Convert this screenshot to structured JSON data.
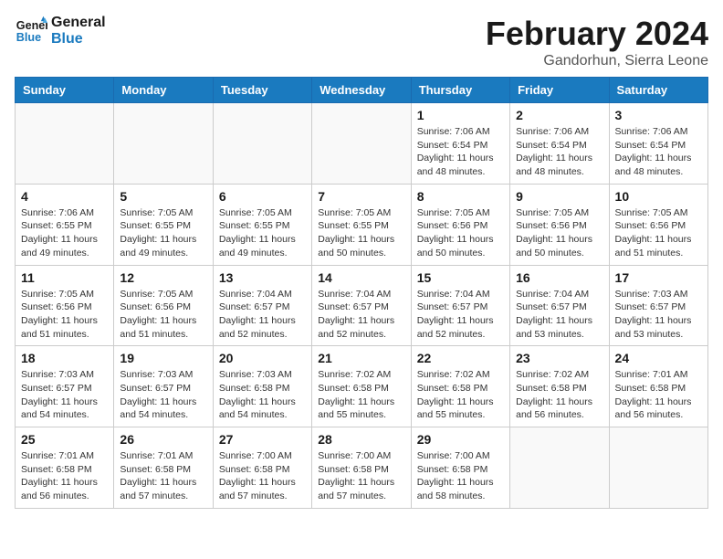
{
  "header": {
    "logo_line1": "General",
    "logo_line2": "Blue",
    "title": "February 2024",
    "subtitle": "Gandorhun, Sierra Leone"
  },
  "weekdays": [
    "Sunday",
    "Monday",
    "Tuesday",
    "Wednesday",
    "Thursday",
    "Friday",
    "Saturday"
  ],
  "weeks": [
    [
      {
        "day": "",
        "info": ""
      },
      {
        "day": "",
        "info": ""
      },
      {
        "day": "",
        "info": ""
      },
      {
        "day": "",
        "info": ""
      },
      {
        "day": "1",
        "info": "Sunrise: 7:06 AM\nSunset: 6:54 PM\nDaylight: 11 hours\nand 48 minutes."
      },
      {
        "day": "2",
        "info": "Sunrise: 7:06 AM\nSunset: 6:54 PM\nDaylight: 11 hours\nand 48 minutes."
      },
      {
        "day": "3",
        "info": "Sunrise: 7:06 AM\nSunset: 6:54 PM\nDaylight: 11 hours\nand 48 minutes."
      }
    ],
    [
      {
        "day": "4",
        "info": "Sunrise: 7:06 AM\nSunset: 6:55 PM\nDaylight: 11 hours\nand 49 minutes."
      },
      {
        "day": "5",
        "info": "Sunrise: 7:05 AM\nSunset: 6:55 PM\nDaylight: 11 hours\nand 49 minutes."
      },
      {
        "day": "6",
        "info": "Sunrise: 7:05 AM\nSunset: 6:55 PM\nDaylight: 11 hours\nand 49 minutes."
      },
      {
        "day": "7",
        "info": "Sunrise: 7:05 AM\nSunset: 6:55 PM\nDaylight: 11 hours\nand 50 minutes."
      },
      {
        "day": "8",
        "info": "Sunrise: 7:05 AM\nSunset: 6:56 PM\nDaylight: 11 hours\nand 50 minutes."
      },
      {
        "day": "9",
        "info": "Sunrise: 7:05 AM\nSunset: 6:56 PM\nDaylight: 11 hours\nand 50 minutes."
      },
      {
        "day": "10",
        "info": "Sunrise: 7:05 AM\nSunset: 6:56 PM\nDaylight: 11 hours\nand 51 minutes."
      }
    ],
    [
      {
        "day": "11",
        "info": "Sunrise: 7:05 AM\nSunset: 6:56 PM\nDaylight: 11 hours\nand 51 minutes."
      },
      {
        "day": "12",
        "info": "Sunrise: 7:05 AM\nSunset: 6:56 PM\nDaylight: 11 hours\nand 51 minutes."
      },
      {
        "day": "13",
        "info": "Sunrise: 7:04 AM\nSunset: 6:57 PM\nDaylight: 11 hours\nand 52 minutes."
      },
      {
        "day": "14",
        "info": "Sunrise: 7:04 AM\nSunset: 6:57 PM\nDaylight: 11 hours\nand 52 minutes."
      },
      {
        "day": "15",
        "info": "Sunrise: 7:04 AM\nSunset: 6:57 PM\nDaylight: 11 hours\nand 52 minutes."
      },
      {
        "day": "16",
        "info": "Sunrise: 7:04 AM\nSunset: 6:57 PM\nDaylight: 11 hours\nand 53 minutes."
      },
      {
        "day": "17",
        "info": "Sunrise: 7:03 AM\nSunset: 6:57 PM\nDaylight: 11 hours\nand 53 minutes."
      }
    ],
    [
      {
        "day": "18",
        "info": "Sunrise: 7:03 AM\nSunset: 6:57 PM\nDaylight: 11 hours\nand 54 minutes."
      },
      {
        "day": "19",
        "info": "Sunrise: 7:03 AM\nSunset: 6:57 PM\nDaylight: 11 hours\nand 54 minutes."
      },
      {
        "day": "20",
        "info": "Sunrise: 7:03 AM\nSunset: 6:58 PM\nDaylight: 11 hours\nand 54 minutes."
      },
      {
        "day": "21",
        "info": "Sunrise: 7:02 AM\nSunset: 6:58 PM\nDaylight: 11 hours\nand 55 minutes."
      },
      {
        "day": "22",
        "info": "Sunrise: 7:02 AM\nSunset: 6:58 PM\nDaylight: 11 hours\nand 55 minutes."
      },
      {
        "day": "23",
        "info": "Sunrise: 7:02 AM\nSunset: 6:58 PM\nDaylight: 11 hours\nand 56 minutes."
      },
      {
        "day": "24",
        "info": "Sunrise: 7:01 AM\nSunset: 6:58 PM\nDaylight: 11 hours\nand 56 minutes."
      }
    ],
    [
      {
        "day": "25",
        "info": "Sunrise: 7:01 AM\nSunset: 6:58 PM\nDaylight: 11 hours\nand 56 minutes."
      },
      {
        "day": "26",
        "info": "Sunrise: 7:01 AM\nSunset: 6:58 PM\nDaylight: 11 hours\nand 57 minutes."
      },
      {
        "day": "27",
        "info": "Sunrise: 7:00 AM\nSunset: 6:58 PM\nDaylight: 11 hours\nand 57 minutes."
      },
      {
        "day": "28",
        "info": "Sunrise: 7:00 AM\nSunset: 6:58 PM\nDaylight: 11 hours\nand 57 minutes."
      },
      {
        "day": "29",
        "info": "Sunrise: 7:00 AM\nSunset: 6:58 PM\nDaylight: 11 hours\nand 58 minutes."
      },
      {
        "day": "",
        "info": ""
      },
      {
        "day": "",
        "info": ""
      }
    ]
  ]
}
